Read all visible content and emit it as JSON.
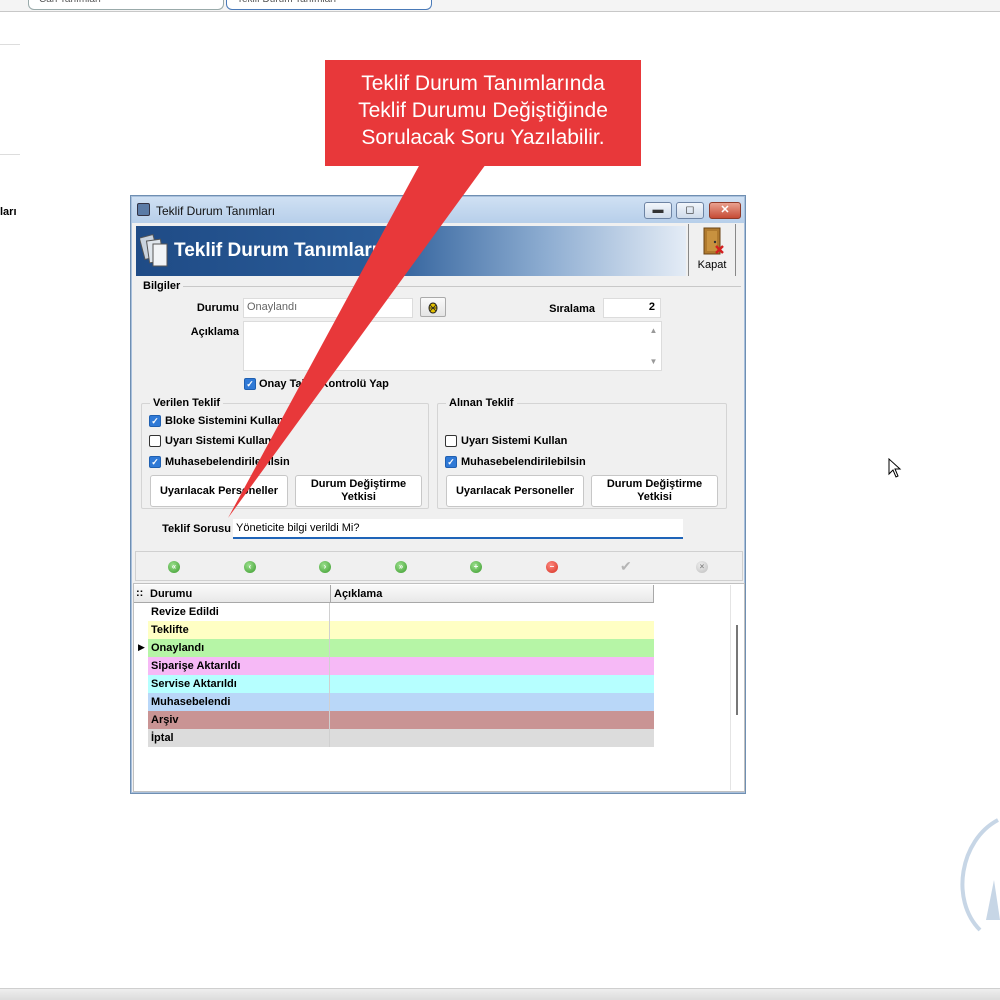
{
  "background": {
    "tabs": [
      "Cari Tanımları",
      "Teklif Durum Tanımları"
    ],
    "left_partial_text": "ları"
  },
  "callout": {
    "lines": [
      "Teklif Durum Tanımlarında",
      "Teklif Durumu Değiştiğinde",
      "Sorulacak Soru Yazılabilir."
    ],
    "color": "#e8383a"
  },
  "window": {
    "title": "Teklif Durum Tanımları",
    "header_title": "Teklif Durum Tanımları",
    "close_action_label": "Kapat",
    "buttons": {
      "minimize": "▬",
      "maximize": "◻",
      "close": "✕"
    }
  },
  "bilgiler": {
    "section_title": "Bilgiler",
    "durumu_label": "Durumu",
    "durumu_value": "Onaylandı",
    "siralama_label": "Sıralama",
    "siralama_value": "2",
    "aciklama_label": "Açıklama",
    "aciklama_value": "",
    "onay_check_label": "Onay Takip Kontrolü Yap",
    "onay_checked": true
  },
  "verilen_teklif": {
    "title": "Verilen Teklif",
    "checks": [
      {
        "label": "Bloke Sistemini Kullan",
        "checked": true
      },
      {
        "label": "Uyarı Sistemi Kullan",
        "checked": false
      },
      {
        "label": "Muhasebelendirilebilsin",
        "checked": true
      }
    ],
    "btn_personel": "Uyarılacak Personeller",
    "btn_yetki_line1": "Durum Değiştirme",
    "btn_yetki_line2": "Yetkisi"
  },
  "alinan_teklif": {
    "title": "Alınan Teklif",
    "checks": [
      {
        "label": "Uyarı Sistemi Kullan",
        "checked": false
      },
      {
        "label": "Muhasebelendirilebilsin",
        "checked": true
      }
    ],
    "btn_personel": "Uyarılacak Personeller",
    "btn_yetki_line1": "Durum Değiştirme",
    "btn_yetki_line2": "Yetkisi"
  },
  "teklif_sorusu": {
    "label": "Teklif Sorusu",
    "value": "Yöneticite bilgi verildi Mi?"
  },
  "navigator": {
    "icons": [
      "first-icon",
      "prior-icon",
      "next-icon",
      "last-icon",
      "insert-icon",
      "delete-icon",
      "post-icon",
      "cancel-icon"
    ]
  },
  "grid": {
    "indicator": "::",
    "columns": [
      "Durumu",
      "Açıklama"
    ],
    "current_row_index": 2,
    "rows": [
      {
        "durumu": "Revize Edildi",
        "aciklama": "",
        "color": "#ffffff"
      },
      {
        "durumu": "Teklifte",
        "aciklama": "",
        "color": "#ffffc4"
      },
      {
        "durumu": "Onaylandı",
        "aciklama": "",
        "color": "#b6f5a6"
      },
      {
        "durumu": "Siparişe Aktarıldı",
        "aciklama": "",
        "color": "#f6b9f6"
      },
      {
        "durumu": "Servise Aktarıldı",
        "aciklama": "",
        "color": "#b6ffff"
      },
      {
        "durumu": "Muhasebelendi",
        "aciklama": "",
        "color": "#b9d7f8"
      },
      {
        "durumu": "Arşiv",
        "aciklama": "",
        "color": "#c99494"
      },
      {
        "durumu": "İptal",
        "aciklama": "",
        "color": "#dcdcdc"
      }
    ]
  }
}
